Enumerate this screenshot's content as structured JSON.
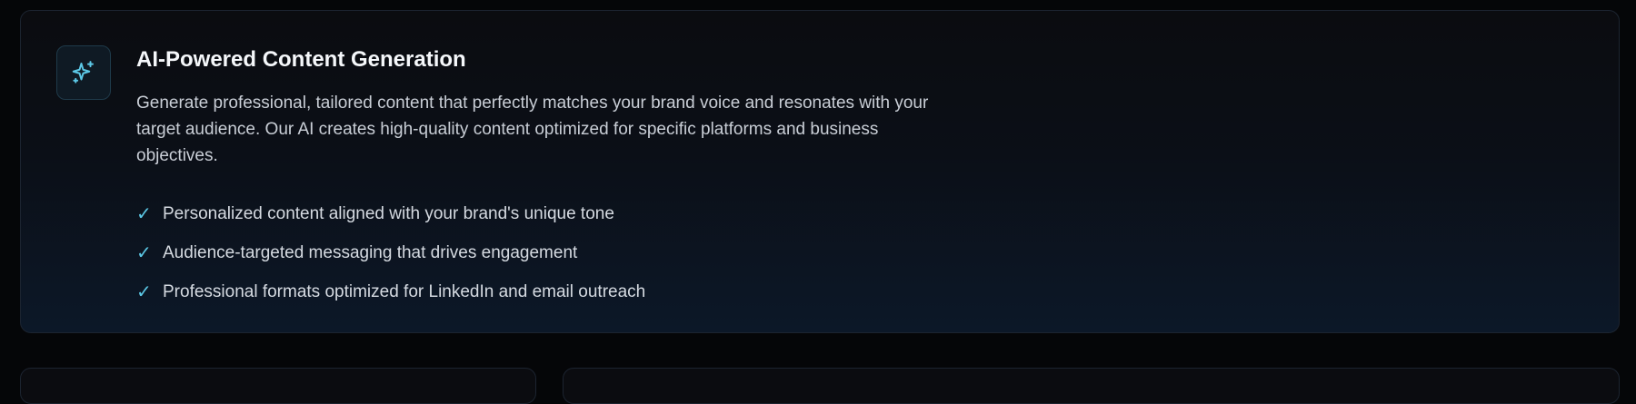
{
  "feature": {
    "icon": "sparkles-icon",
    "title": "AI-Powered Content Generation",
    "description": "Generate professional, tailored content that perfectly matches your brand voice and resonates with your target audience. Our AI creates high-quality content optimized for specific platforms and business objectives.",
    "check_mark": "✓",
    "items": [
      "Personalized content aligned with your brand's unique tone",
      "Audience-targeted messaging that drives engagement",
      "Professional formats optimized for LinkedIn and email outreach"
    ]
  },
  "colors": {
    "accent": "#5cc8e6",
    "background": "#050608",
    "card_border": "#1c2430"
  }
}
